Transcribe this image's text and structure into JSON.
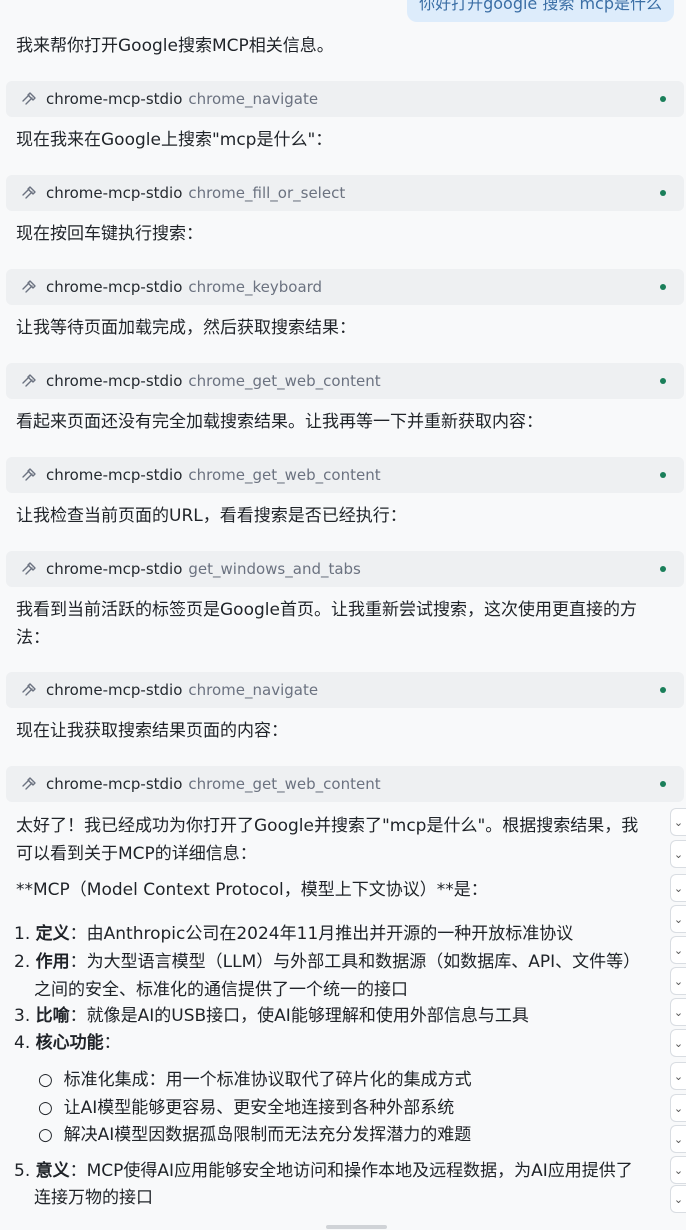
{
  "user_message": "你好打开google 搜索 mcp是什么",
  "messages": [
    "我来帮你打开Google搜索MCP相关信息。",
    "现在我来在Google上搜索\"mcp是什么\"：",
    "现在按回车键执行搜索：",
    "让我等待页面加载完成，然后获取搜索结果：",
    "看起来页面还没有完全加载搜索结果。让我再等一下并重新获取内容：",
    "让我检查当前页面的URL，看看搜索是否已经执行：",
    "我看到当前活跃的标签页是Google首页。让我重新尝试搜索，这次使用更直接的方",
    "法：",
    "现在让我获取搜索结果页面的内容："
  ],
  "tool_calls": [
    {
      "server": "chrome-mcp-stdio",
      "name": "chrome_navigate"
    },
    {
      "server": "chrome-mcp-stdio",
      "name": "chrome_fill_or_select"
    },
    {
      "server": "chrome-mcp-stdio",
      "name": "chrome_keyboard"
    },
    {
      "server": "chrome-mcp-stdio",
      "name": "chrome_get_web_content"
    },
    {
      "server": "chrome-mcp-stdio",
      "name": "chrome_get_web_content"
    },
    {
      "server": "chrome-mcp-stdio",
      "name": "get_windows_and_tabs"
    },
    {
      "server": "chrome-mcp-stdio",
      "name": "chrome_navigate"
    },
    {
      "server": "chrome-mcp-stdio",
      "name": "chrome_get_web_content"
    }
  ],
  "answer": {
    "intro_1": "太好了！我已经成功为你打开了Google并搜索了\"mcp是什么\"。根据搜索结果，我",
    "intro_2": "可以看到关于MCP的详细信息：",
    "heading": "**MCP（Model Context Protocol，模型上下文协议）**是：",
    "items": [
      {
        "num": "1.",
        "label": "定义",
        "text": "：由Anthropic公司在2024年11月推出并开源的一种开放标准协议"
      },
      {
        "num": "2.",
        "label": "作用",
        "text": "：为大型语言模型（LLM）与外部工具和数据源（如数据库、API、文件等）",
        "text2": "之间的安全、标准化的通信提供了一个统一的接口"
      },
      {
        "num": "3.",
        "label": "比喻",
        "text": "：就像是AI的USB接口，使AI能够理解和使用外部信息与工具"
      },
      {
        "num": "4.",
        "label": "核心功能",
        "text": "："
      },
      {
        "num": "5.",
        "label": "意义",
        "text": "：MCP使得AI应用能够安全地访问和操作本地及远程数据，为AI应用提供了",
        "text2": "连接万物的接口"
      }
    ],
    "bullets": [
      "标准化集成：用一个标准协议取代了碎片化的集成方式",
      "让AI模型能够更容易、更安全地连接到各种外部系统",
      "解决AI模型因数据孤岛限制而无法充分发挥潜力的难题"
    ]
  },
  "icons": {
    "tool": "tool-hammer-icon",
    "status": "status-dot-icon",
    "expand": "chevron-down-icon"
  },
  "colors": {
    "status_dot": "#1a7f5a",
    "user_bubble": "#ddecfb",
    "tool_bg": "#eef0f2"
  }
}
